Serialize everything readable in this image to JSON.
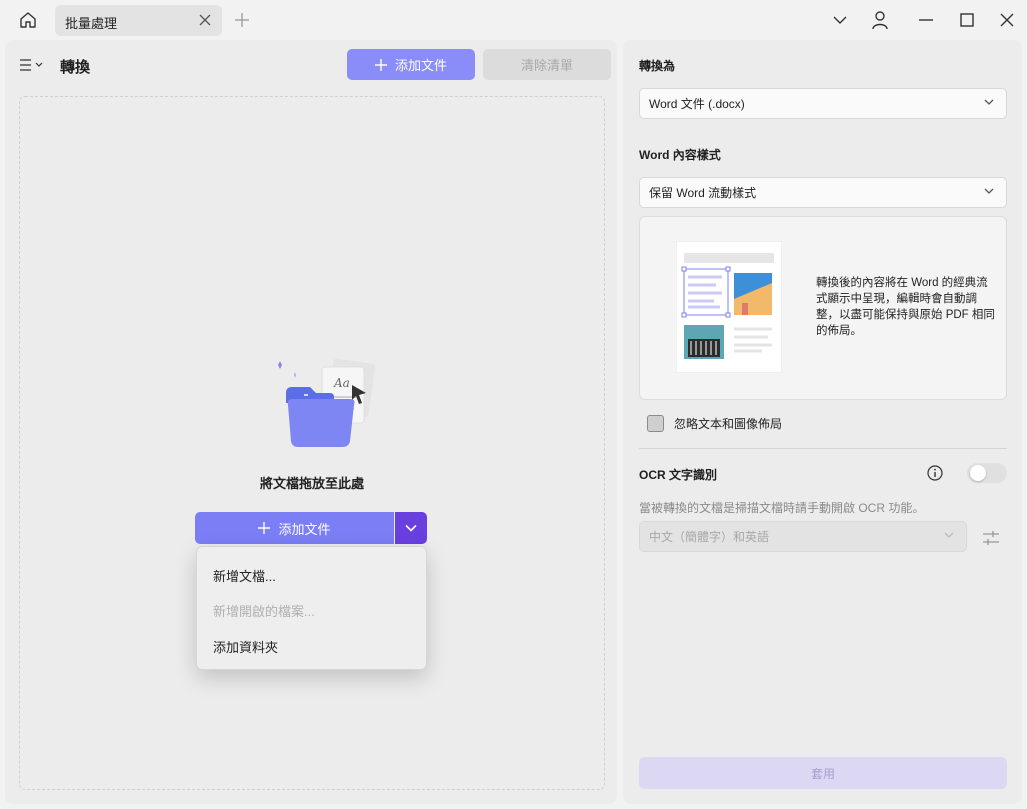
{
  "titlebar": {
    "tab_label": "批量處理"
  },
  "left": {
    "title": "轉換",
    "add_file_label": "添加文件",
    "clear_list_label": "清除清單",
    "drop_text": "將文檔拖放至此處",
    "split_add_label": "添加文件",
    "menu": {
      "new_doc": "新增文檔...",
      "new_opened": "新增開啟的檔案...",
      "add_folder": "添加資料夾"
    }
  },
  "right": {
    "convert_to_label": "轉換為",
    "convert_to_value": "Word 文件 (.docx)",
    "word_style_label": "Word 內容樣式",
    "word_style_value": "保留 Word 流動樣式",
    "preview_description": "轉換後的內容將在 Word 的經典流式顯示中呈現，編輯時會自動調整，以盡可能保持與原始 PDF 相同的佈局。",
    "ignore_layout_label": "忽略文本和圖像佈局",
    "ocr_label": "OCR 文字識別",
    "ocr_description": "當被轉換的文檔是掃描文檔時請手動開啟 OCR 功能。",
    "ocr_language_value": "中文（簡體字）和英語",
    "apply_label": "套用"
  },
  "colors": {
    "accent": "#7b7ef5",
    "accent_dark": "#6a3fe0",
    "apply_disabled": "#dcd8f4"
  }
}
